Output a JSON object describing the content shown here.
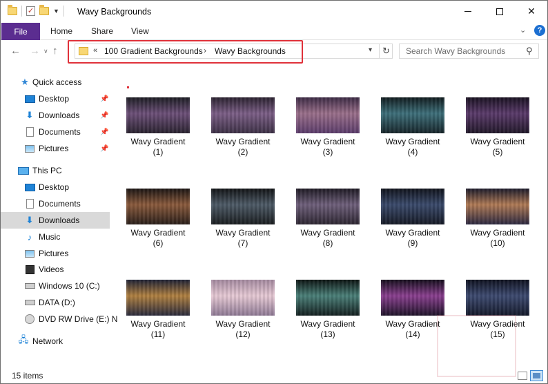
{
  "window": {
    "title": "Wavy Backgrounds"
  },
  "ribbon": {
    "file": "File",
    "home": "Home",
    "share": "Share",
    "view": "View"
  },
  "address": {
    "overflow": "«",
    "crumbs": [
      "100 Gradient Backgrounds",
      "Wavy Backgrounds"
    ],
    "separator": "›"
  },
  "search": {
    "placeholder": "Search Wavy Backgrounds"
  },
  "sidebar": {
    "items": [
      {
        "label": "Quick access",
        "icon": "star-icon"
      },
      {
        "label": "Desktop",
        "icon": "desktop-icon",
        "pinned": true
      },
      {
        "label": "Downloads",
        "icon": "downloads-icon",
        "pinned": true
      },
      {
        "label": "Documents",
        "icon": "documents-icon",
        "pinned": true
      },
      {
        "label": "Pictures",
        "icon": "pictures-icon",
        "pinned": true
      },
      {
        "label": "This PC",
        "icon": "pc-icon"
      },
      {
        "label": "Desktop",
        "icon": "desktop-icon"
      },
      {
        "label": "Documents",
        "icon": "documents-icon"
      },
      {
        "label": "Downloads",
        "icon": "downloads-icon",
        "selected": true
      },
      {
        "label": "Music",
        "icon": "music-icon"
      },
      {
        "label": "Pictures",
        "icon": "pictures-icon"
      },
      {
        "label": "Videos",
        "icon": "videos-icon"
      },
      {
        "label": "Windows 10 (C:)",
        "icon": "windows-drive-icon"
      },
      {
        "label": "DATA (D:)",
        "icon": "drive-icon"
      },
      {
        "label": "DVD RW Drive (E:) N",
        "icon": "dvd-icon"
      },
      {
        "label": "Network",
        "icon": "network-icon"
      }
    ]
  },
  "files": [
    {
      "name": "Wavy Gradient",
      "num": "(1)",
      "colors": [
        "#1d1d24",
        "#6c4f78",
        "#2a2330"
      ]
    },
    {
      "name": "Wavy Gradient",
      "num": "(2)",
      "colors": [
        "#2b2230",
        "#7b5e86",
        "#3d3146"
      ]
    },
    {
      "name": "Wavy Gradient",
      "num": "(3)",
      "colors": [
        "#3d2b45",
        "#9a6f8a",
        "#5b3c6b"
      ]
    },
    {
      "name": "Wavy Gradient",
      "num": "(4)",
      "colors": [
        "#111c1f",
        "#3d6f7a",
        "#17252a"
      ]
    },
    {
      "name": "Wavy Gradient",
      "num": "(5)",
      "colors": [
        "#1a1222",
        "#5a3a6a",
        "#211829"
      ]
    },
    {
      "name": "Wavy Gradient",
      "num": "(6)",
      "colors": [
        "#1b1513",
        "#8a5a3c",
        "#2a1f1a"
      ]
    },
    {
      "name": "Wavy Gradient",
      "num": "(7)",
      "colors": [
        "#121416",
        "#4d5a66",
        "#1a1d20"
      ]
    },
    {
      "name": "Wavy Gradient",
      "num": "(8)",
      "colors": [
        "#1e1a24",
        "#6e5f7a",
        "#2d2632"
      ]
    },
    {
      "name": "Wavy Gradient",
      "num": "(9)",
      "colors": [
        "#10131c",
        "#3a4a6b",
        "#161a26"
      ]
    },
    {
      "name": "Wavy Gradient",
      "num": "(10)",
      "colors": [
        "#1c1b2a",
        "#b07a55",
        "#2c2840"
      ]
    },
    {
      "name": "Wavy Gradient",
      "num": "(11)",
      "colors": [
        "#1f2234",
        "#b08040",
        "#2a2a3c"
      ]
    },
    {
      "name": "Wavy Gradient",
      "num": "(12)",
      "colors": [
        "#a58aa0",
        "#e6c9d4",
        "#8f7a95"
      ]
    },
    {
      "name": "Wavy Gradient",
      "num": "(13)",
      "colors": [
        "#0d1513",
        "#4a7f78",
        "#142020"
      ]
    },
    {
      "name": "Wavy Gradient",
      "num": "(14)",
      "colors": [
        "#160f1d",
        "#8a3f8f",
        "#20142a"
      ]
    },
    {
      "name": "Wavy Gradient",
      "num": "(15)",
      "colors": [
        "#0f1220",
        "#3d4a70",
        "#151a2b"
      ]
    }
  ],
  "status": {
    "count": "15 items"
  }
}
